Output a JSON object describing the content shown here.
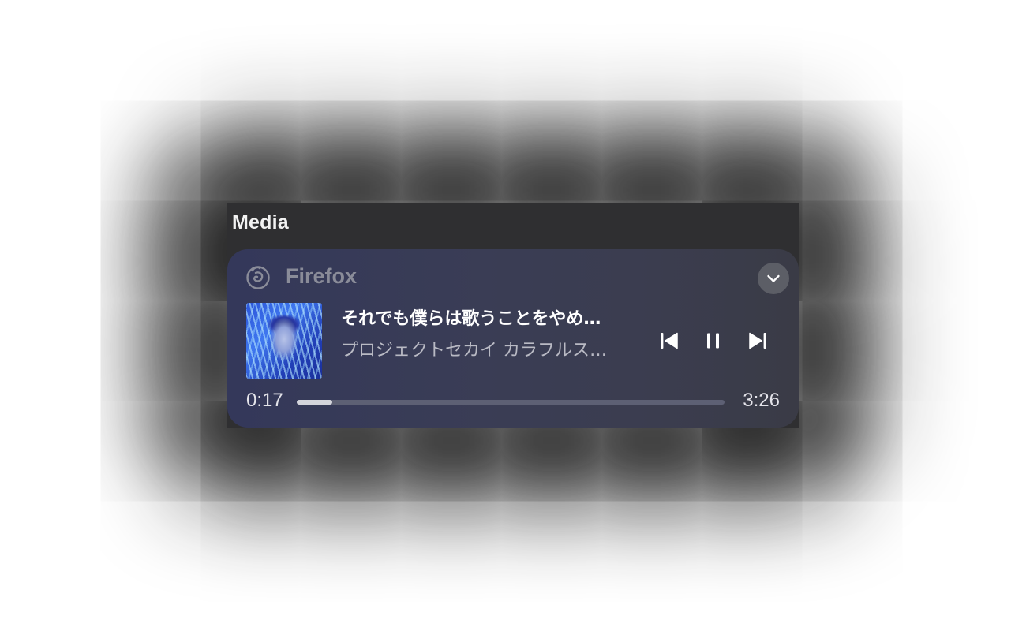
{
  "section": {
    "title": "Media"
  },
  "player": {
    "app_name": "Firefox",
    "app_icon": "firefox-icon",
    "expand_icon": "chevron-down-icon",
    "track_title": "それでも僕らは歌うことをやめ…",
    "track_artist": "プロジェクトセカイ カラフルス…",
    "elapsed": "0:17",
    "duration": "3:26",
    "progress_fraction": 0.0825,
    "controls": {
      "previous_icon": "skip-previous-icon",
      "pause_icon": "pause-icon",
      "next_icon": "skip-next-icon"
    }
  },
  "colors": {
    "card_left": "#34385a",
    "card_right": "#3a3b46",
    "progress_track": "#5d6074",
    "progress_fill": "#d4d5dc"
  }
}
